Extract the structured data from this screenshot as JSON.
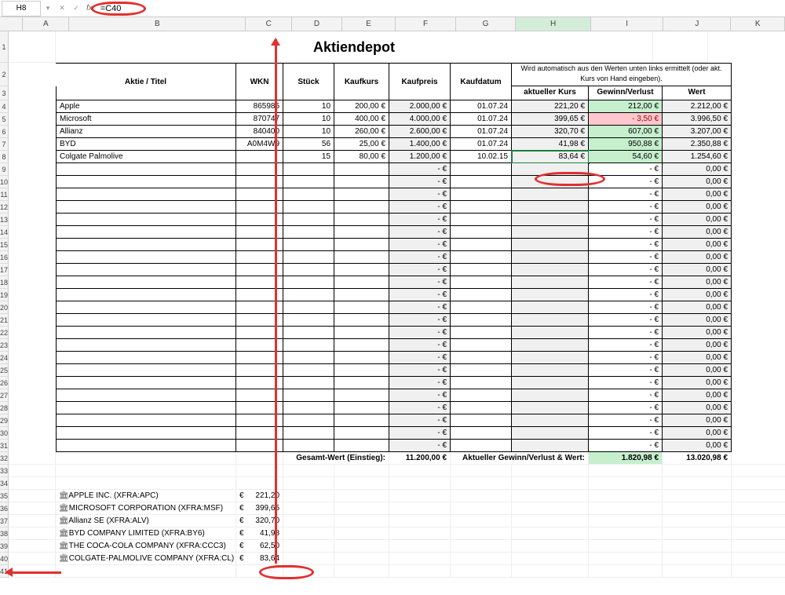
{
  "formula_bar": {
    "name_box": "H8",
    "fx": "fx",
    "formula": "=C40"
  },
  "columns": [
    "A",
    "B",
    "C",
    "D",
    "E",
    "F",
    "G",
    "H",
    "I",
    "J",
    "K"
  ],
  "title": "Aktiendepot",
  "headers": {
    "aktie": "Aktie / Titel",
    "wkn": "WKN",
    "stuck": "Stück",
    "kaufkurs": "Kaufkurs",
    "kaufpreis": "Kaufpreis",
    "kaufdatum": "Kaufdatum",
    "auto_note": "Wird automatisch aus den Werten unten links ermittelt (oder akt. Kurs von Hand eingeben).",
    "aktueller": "aktueller Kurs",
    "gewinn": "Gewinn/Verlust",
    "wert": "Wert"
  },
  "rows": [
    {
      "r": 4,
      "aktie": "Apple",
      "wkn": "865985",
      "stuck": "10",
      "kaufkurs": "200,00 €",
      "kaufpreis": "2.000,00 €",
      "kaufdatum": "01.07.24",
      "akt": "221,20 €",
      "gw": "212,00 €",
      "gw_cls": "green",
      "wert": "2.212,00 €"
    },
    {
      "r": 5,
      "aktie": "Microsoft",
      "wkn": "870747",
      "stuck": "10",
      "kaufkurs": "400,00 €",
      "kaufpreis": "4.000,00 €",
      "kaufdatum": "01.07.24",
      "akt": "399,65 €",
      "gw": "-       3,50 €",
      "gw_cls": "red",
      "wert": "3.996,50 €"
    },
    {
      "r": 6,
      "aktie": "Allianz",
      "wkn": "840400",
      "stuck": "10",
      "kaufkurs": "260,00 €",
      "kaufpreis": "2.600,00 €",
      "kaufdatum": "01.07.24",
      "akt": "320,70 €",
      "gw": "607,00 €",
      "gw_cls": "green",
      "wert": "3.207,00 €"
    },
    {
      "r": 7,
      "aktie": "BYD",
      "wkn": "A0M4W9",
      "stuck": "56",
      "kaufkurs": "25,00 €",
      "kaufpreis": "1.400,00 €",
      "kaufdatum": "01.07.24",
      "akt": "41,98 €",
      "gw": "950,88 €",
      "gw_cls": "green",
      "wert": "2.350,88 €"
    },
    {
      "r": 8,
      "aktie": "Colgate Palmolive",
      "wkn": "",
      "stuck": "15",
      "kaufkurs": "80,00 €",
      "kaufpreis": "1.200,00 €",
      "kaufdatum": "10.02.15",
      "akt": "83,64 €",
      "gw": "54,60 €",
      "gw_cls": "green",
      "wert": "1.254,60 €",
      "selected": true
    }
  ],
  "empty_row": {
    "kaufpreis": "-   €",
    "akt": "",
    "gw": "-   €",
    "wert": "0,00 €"
  },
  "empty_range": [
    9,
    10,
    11,
    12,
    13,
    14,
    15,
    16,
    17,
    18,
    19,
    20,
    21,
    22,
    23,
    24,
    25,
    26,
    27,
    28,
    29,
    30,
    31
  ],
  "totals": {
    "r": 32,
    "label_einstieg": "Gesamt-Wert (Einstieg):",
    "einstieg": "11.200,00 €",
    "label_aktuell": "Aktueller Gewinn/Verlust & Wert:",
    "gw": "1.820,98 €",
    "wert": "13.020,98 €"
  },
  "live": [
    {
      "r": 35,
      "name": "APPLE INC. (XFRA:APC)",
      "cur": "€",
      "val": "221,20"
    },
    {
      "r": 36,
      "name": "MICROSOFT CORPORATION (XFRA:MSF)",
      "cur": "€",
      "val": "399,65"
    },
    {
      "r": 37,
      "name": "Allianz SE (XFRA:ALV)",
      "cur": "€",
      "val": "320,70"
    },
    {
      "r": 38,
      "name": "BYD COMPANY LIMITED (XFRA:BY6)",
      "cur": "€",
      "val": "41,98"
    },
    {
      "r": 39,
      "name": "THE COCA-COLA COMPANY (XFRA:CCC3)",
      "cur": "€",
      "val": "62,50"
    },
    {
      "r": 40,
      "name": "COLGATE-PALMOLIVE COMPANY (XFRA:CL)",
      "cur": "€",
      "val": "83,64"
    }
  ],
  "icon": "🏛"
}
